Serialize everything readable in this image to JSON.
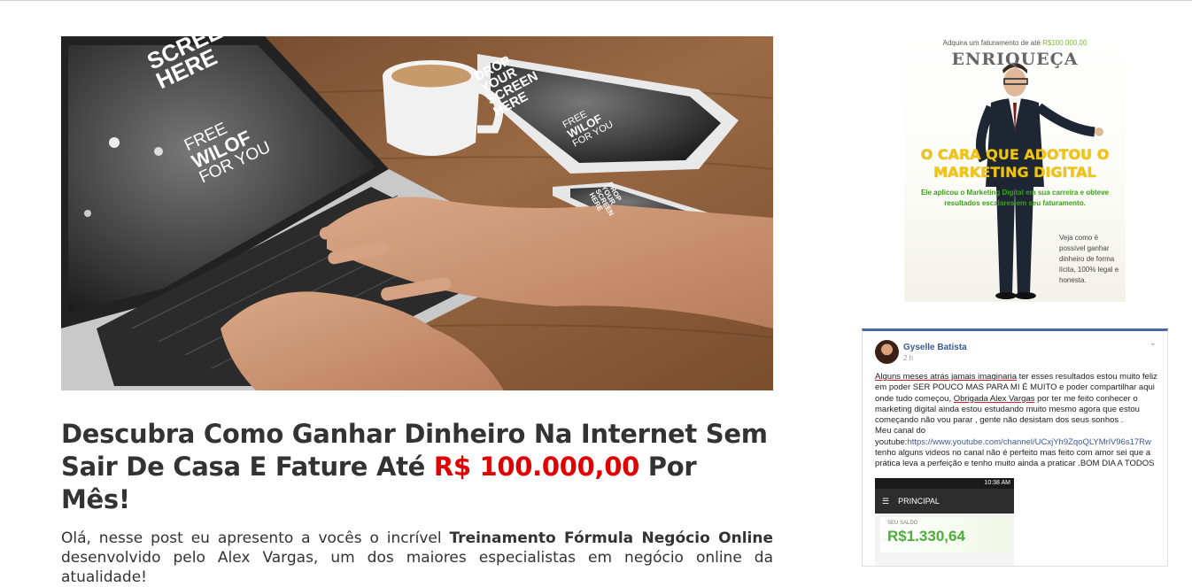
{
  "hero": {
    "screen_text_laptop_top": "SCREEN HERE",
    "screen_text_laptop": [
      "FREE",
      "WILOF",
      "FOR YOU"
    ],
    "screen_text_tablet": [
      "DROP",
      "YOUR",
      "SCREEN",
      "HERE"
    ],
    "screen_text_tablet_bottom": [
      "FREE",
      "WILOF",
      "FOR YOU"
    ],
    "screen_text_phone": [
      "DROP",
      "YOUR",
      "SCREEN",
      "HERE"
    ]
  },
  "article": {
    "headline_part1": "Descubra Como Ganhar Dinheiro Na Internet Sem Sair De Casa E Fature Até ",
    "headline_highlight": "R$ 100.000,00",
    "headline_part2": " Por Mês!",
    "intro_part1": "Olá, nesse post eu apresento a vocês o incrível ",
    "intro_bold": "Treinamento Fórmula Negócio Online",
    "intro_part2": " desenvolvido pelo Alex Vargas, um dos maiores especialistas em negócio online da atualidade!"
  },
  "ad": {
    "top_text": "Adquira um faturamento de até ",
    "top_amount": "R$100.000,00",
    "brand": "ENRIQUEÇA",
    "headline": "O CARA QUE ADOTOU O MARKETING DIGITAL",
    "subtext": "Ele aplicou o Marketing Digital em sua carreira e obteve resultados escalares em seu faturamento.",
    "side_text": "Veja como é possível ganhar dinheiro de forma lícita, 100% legal e honesta."
  },
  "testimonial": {
    "name": "Gyselle Batista",
    "time": "2 h",
    "text_underlined1": "Alguns meses atrás jamais imaginaria",
    "text1": " ter esses resultados estou muito feliz em poder SER POUCO MAS PARA MI É MUITO e poder compartilhar aqui onde tudo começou, ",
    "text_underlined2": "Obrigada Alex Vargas",
    "text2": " por ter me feito conhecer o marketing digital ainda estou estudando muito mesmo agora que estou começando não vou parar , gente não desistam dos seus sonhos .",
    "channel_label": "Meu canal do youtube:",
    "channel_link": "https://www.youtube.com/channel/UCxjYh9ZqoQLYMrlV96s17Rw",
    "text3": "tenho alguns videos no canal não é perfeito mas feito com amor sei que a prática leva a perfeição e tenho muito ainda a praticar .BOM DIA A TODOS",
    "phone_status": "10:38 AM",
    "phone_title": "PRINCIPAL",
    "phone_balance_label": "SEU SALDO",
    "phone_balance": "R$1.330,64"
  }
}
